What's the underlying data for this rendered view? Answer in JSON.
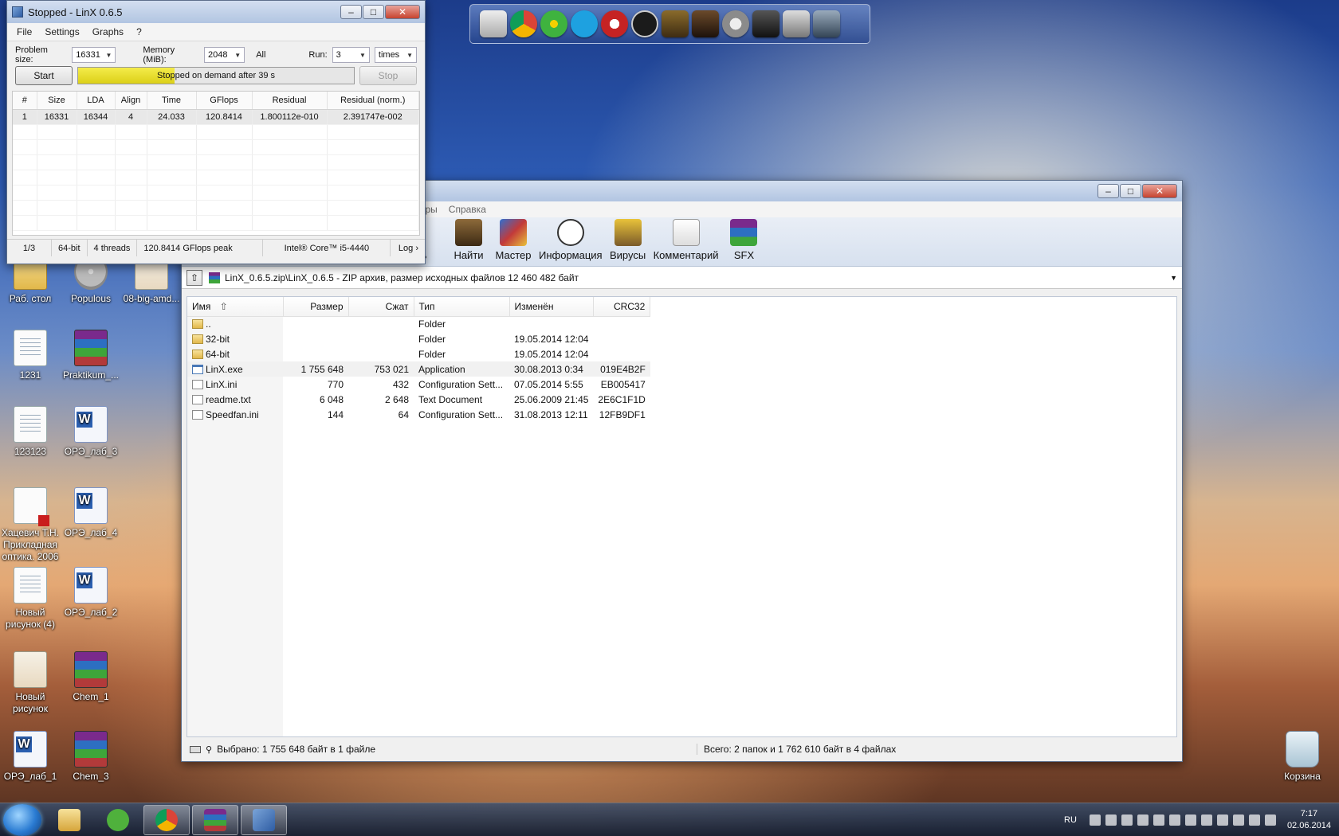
{
  "desktop": {
    "icons": [
      {
        "label": "Раб. стол"
      },
      {
        "label": "Populous"
      },
      {
        "label": "08-big-amd..."
      },
      {
        "label": "1231"
      },
      {
        "label": "Praktikum_..."
      },
      {
        "label": "123123"
      },
      {
        "label": "ОРЭ_лаб_3"
      },
      {
        "label": "Хацевич Т.Н. Прикладная оптика. 2006"
      },
      {
        "label": "ОРЭ_лаб_4"
      },
      {
        "label": "Новый рисунок (4)"
      },
      {
        "label": "ОРЭ_лаб_2"
      },
      {
        "label": "Новый рисунок"
      },
      {
        "label": "Chem_1"
      },
      {
        "label": "ОРЭ_лаб_1"
      },
      {
        "label": "Chem_3"
      },
      {
        "label": "Корзина"
      }
    ]
  },
  "dock": {
    "apps": [
      "file-icon",
      "chrome-icon",
      "icq-icon",
      "skype-icon",
      "game-icon",
      "watchdogs-icon",
      "game2-icon",
      "game3-icon",
      "settings-icon",
      "game4-icon",
      "game5-icon",
      "game6-icon"
    ]
  },
  "linx": {
    "title": "Stopped - LinX 0.6.5",
    "menu": [
      "File",
      "Settings",
      "Graphs",
      "?"
    ],
    "problem_size_label": "Problem size:",
    "problem_size": "16331",
    "memory_label": "Memory (MiB):",
    "memory": "2048",
    "all_label": "All",
    "run_label": "Run:",
    "run": "3",
    "times": "times",
    "start": "Start",
    "stop": "Stop",
    "progress_text": "Stopped on demand after 39 s",
    "progress_fraction": 0.35,
    "columns": [
      "#",
      "Size",
      "LDA",
      "Align",
      "Time",
      "GFlops",
      "Residual",
      "Residual (norm.)"
    ],
    "rows": [
      [
        "1",
        "16331",
        "16344",
        "4",
        "24.033",
        "120.8414",
        "1.800112e-010",
        "2.391747e-002"
      ]
    ],
    "status": [
      "1/3",
      "64-bit",
      "4 threads",
      "120.8414 GFlops peak",
      "Intel® Core™ i5-4440",
      "Log ›"
    ]
  },
  "rar": {
    "menu": [
      "тры",
      "Справка"
    ],
    "toolbar": [
      {
        "label": "ь",
        "icon": "extract-icon"
      },
      {
        "label": "Найти",
        "icon": "find-icon"
      },
      {
        "label": "Мастер",
        "icon": "wizard-icon"
      },
      {
        "label": "Информация",
        "icon": "info-icon"
      },
      {
        "label": "Вирусы",
        "icon": "virus-icon"
      },
      {
        "label": "Комментарий",
        "icon": "comment-icon"
      },
      {
        "label": "SFX",
        "icon": "sfx-icon"
      }
    ],
    "path": "LinX_0.6.5.zip\\LinX_0.6.5 - ZIP архив, размер исходных файлов 12 460 482 байт",
    "columns": [
      "Имя",
      "Размер",
      "Сжат",
      "Тип",
      "Изменён",
      "CRC32"
    ],
    "files": [
      {
        "name": "..",
        "size": "",
        "packed": "",
        "type": "Folder",
        "modified": "",
        "crc": "",
        "icon": "folder"
      },
      {
        "name": "32-bit",
        "size": "",
        "packed": "",
        "type": "Folder",
        "modified": "19.05.2014 12:04",
        "crc": "",
        "icon": "folder"
      },
      {
        "name": "64-bit",
        "size": "",
        "packed": "",
        "type": "Folder",
        "modified": "19.05.2014 12:04",
        "crc": "",
        "icon": "folder"
      },
      {
        "name": "LinX.exe",
        "size": "1 755 648",
        "packed": "753 021",
        "type": "Application",
        "modified": "30.08.2013 0:34",
        "crc": "019E4B2F",
        "icon": "exe"
      },
      {
        "name": "LinX.ini",
        "size": "770",
        "packed": "432",
        "type": "Configuration Sett...",
        "modified": "07.05.2014 5:55",
        "crc": "EB005417",
        "icon": "ini"
      },
      {
        "name": "readme.txt",
        "size": "6 048",
        "packed": "2 648",
        "type": "Text Document",
        "modified": "25.06.2009 21:45",
        "crc": "2E6C1F1D",
        "icon": "txt"
      },
      {
        "name": "Speedfan.ini",
        "size": "144",
        "packed": "64",
        "type": "Configuration Sett...",
        "modified": "31.08.2013 12:11",
        "crc": "12FB9DF1",
        "icon": "ini"
      }
    ],
    "status_left": "Выбрано: 1 755 648 байт в 1 файле",
    "status_right": "Всего: 2 папок и 1 762 610 байт в 4 файлах"
  },
  "taskbar": {
    "language": "RU",
    "time": "7:17",
    "date": "02.06.2014"
  },
  "colors": {
    "progress_fill": "#e8dd2a",
    "title_bar": "#c3d3ea"
  }
}
